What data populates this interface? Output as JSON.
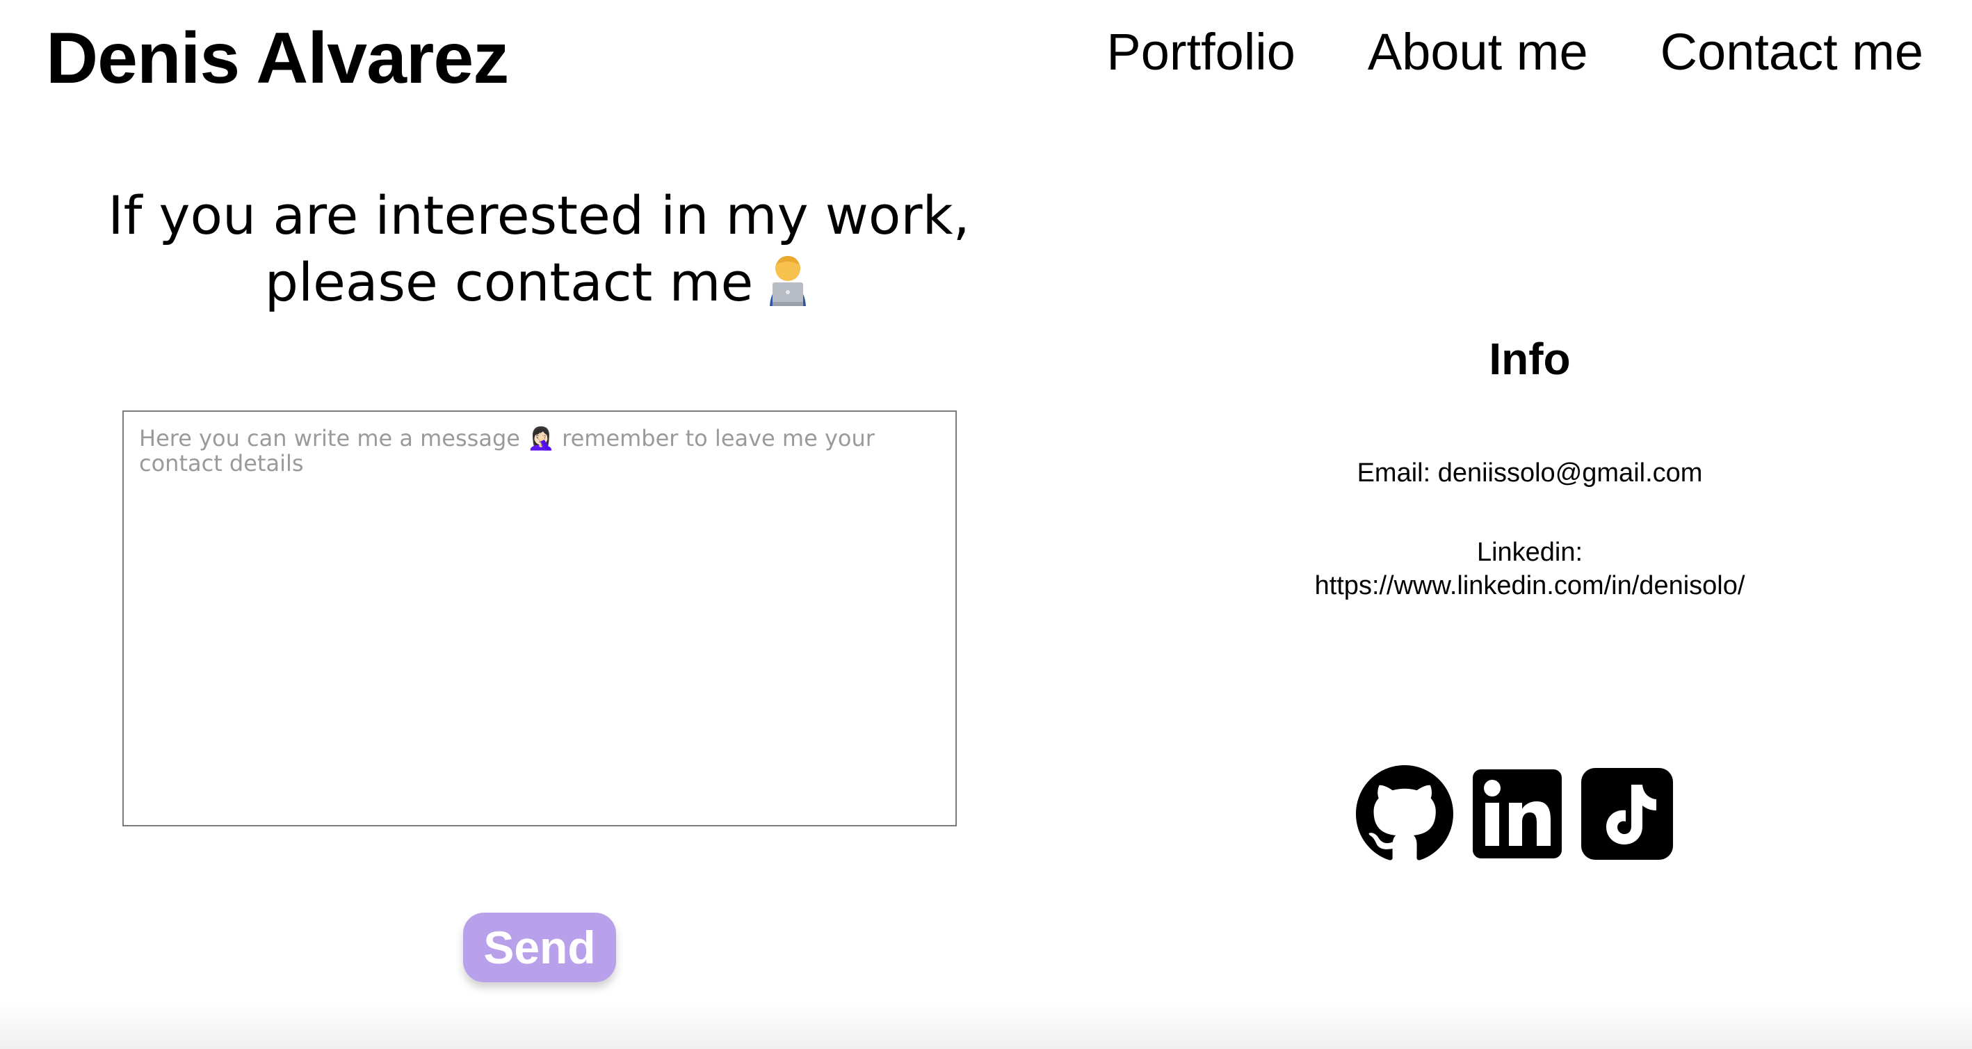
{
  "header": {
    "brand": "Denis Alvarez",
    "nav": [
      "Portfolio",
      "About me",
      "Contact me"
    ]
  },
  "contact": {
    "headline_line1": "If you are interested in my work,",
    "headline_line2": "please contact me",
    "message_placeholder": "Here you can write me a message 🤦🏻‍♀️ remember to leave me your contact details",
    "message_value": "",
    "send_label": "Send"
  },
  "info": {
    "title": "Info",
    "email": "Email: deniissolo@gmail.com",
    "linkedin_label": "Linkedin:",
    "linkedin_url": "https://www.linkedin.com/in/denisolo/"
  },
  "socials": [
    {
      "icon": "github-icon"
    },
    {
      "icon": "linkedin-icon"
    },
    {
      "icon": "tiktok-icon"
    }
  ],
  "colors": {
    "send_button": "#b9a0ea",
    "text": "#000000",
    "background": "#ffffff"
  }
}
